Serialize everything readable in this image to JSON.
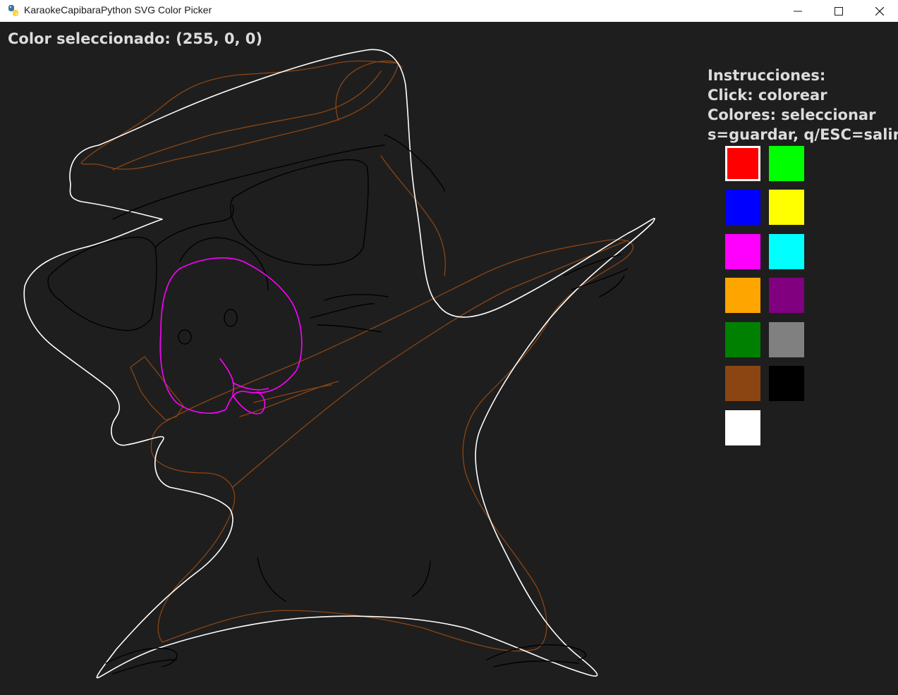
{
  "window": {
    "title": "KaraokeCapibaraPython SVG Color Picker",
    "app_icon": "python-snake-icon",
    "controls": [
      "minimize-icon",
      "maximize-icon",
      "close-icon"
    ]
  },
  "status": {
    "text": "Color seleccionado: (255, 0, 0)",
    "selected_rgb": [
      255,
      0,
      0
    ]
  },
  "instructions": {
    "heading": "Instrucciones:",
    "lines": [
      "Click: colorear",
      "Colores: seleccionar",
      "s=guardar, q/ESC=salir"
    ]
  },
  "palette": {
    "selected_index": 0,
    "colors": [
      "#ff0000",
      "#00ff00",
      "#0000ff",
      "#ffff00",
      "#ff00ff",
      "#00ffff",
      "#ffa500",
      "#800080",
      "#008000",
      "#808080",
      "#8b4513",
      "#000000",
      "#ffffff"
    ]
  },
  "colors": {
    "background": "#1e1e1e",
    "text": "#dcdcdc",
    "outline_white": "#ffffff",
    "outline_brown": "#8b4513",
    "outline_magenta": "#ff00ff",
    "outline_black": "#000000"
  }
}
